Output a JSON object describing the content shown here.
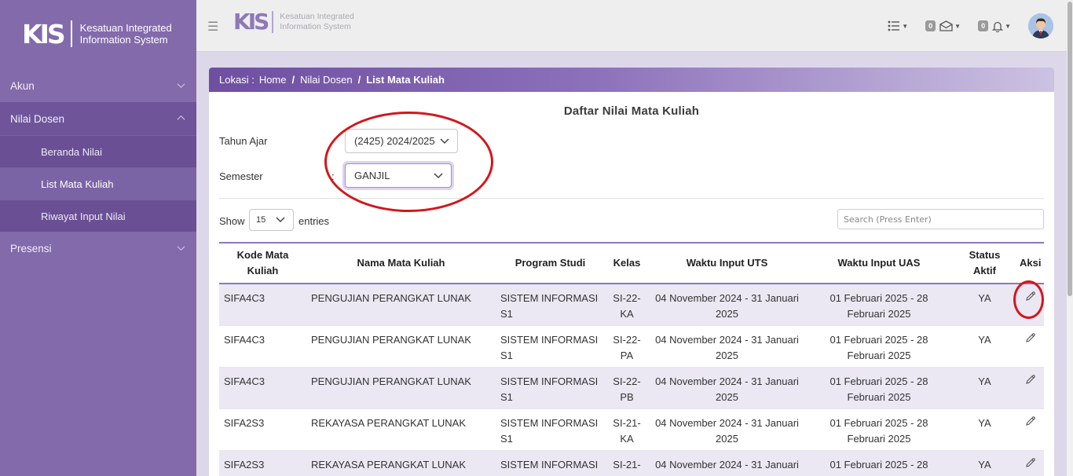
{
  "app": {
    "logo_text": "KIS",
    "name_line1": "Kesatuan Integrated",
    "name_line2": "Information System"
  },
  "sidebar": {
    "items": [
      {
        "label": "Akun",
        "icon": "chevron-down-icon"
      },
      {
        "label": "Nilai Dosen",
        "icon": "chevron-up-icon",
        "children": [
          {
            "label": "Beranda Nilai"
          },
          {
            "label": "List Mata Kuliah",
            "active": true
          },
          {
            "label": "Riwayat Input Nilai"
          }
        ]
      },
      {
        "label": "Presensi",
        "icon": "chevron-down-icon"
      }
    ]
  },
  "topbar": {
    "menu_icon": "hamburger-icon",
    "list_icon": "list-icon",
    "mail_count": "0",
    "mail_icon": "envelope-icon",
    "notif_count": "0",
    "notif_icon": "bell-icon",
    "avatar_icon": "user-avatar"
  },
  "breadcrumb": {
    "prefix": "Lokasi :",
    "items": [
      "Home",
      "Nilai Dosen",
      "List Mata Kuliah"
    ],
    "separator": "/"
  },
  "page_title": "Daftar Nilai Mata Kuliah",
  "filters": {
    "tahun_ajar_label": "Tahun Ajar",
    "tahun_ajar_value": "(2425) 2024/2025",
    "semester_label": "Semester",
    "semester_value": "GANJIL",
    "colon": ":"
  },
  "table_controls": {
    "show_label": "Show",
    "entries_value": "15",
    "entries_label": "entries",
    "search_placeholder": "Search (Press Enter)"
  },
  "table": {
    "headers": [
      "Kode Mata Kuliah",
      "Nama Mata Kuliah",
      "Program Studi",
      "Kelas",
      "Waktu Input UTS",
      "Waktu Input UAS",
      "Status Aktif",
      "Aksi"
    ],
    "rows": [
      {
        "kode": "SIFA4C3",
        "nama": "PENGUJIAN PERANGKAT LUNAK",
        "prodi": "SISTEM INFORMASI S1",
        "kelas": "SI-22-KA",
        "uts": "04 November 2024 - 31 Januari 2025",
        "uas": "01 Februari 2025 - 28 Februari 2025",
        "status": "YA"
      },
      {
        "kode": "SIFA4C3",
        "nama": "PENGUJIAN PERANGKAT LUNAK",
        "prodi": "SISTEM INFORMASI S1",
        "kelas": "SI-22-PA",
        "uts": "04 November 2024 - 31 Januari 2025",
        "uas": "01 Februari 2025 - 28 Februari 2025",
        "status": "YA"
      },
      {
        "kode": "SIFA4C3",
        "nama": "PENGUJIAN PERANGKAT LUNAK",
        "prodi": "SISTEM INFORMASI S1",
        "kelas": "SI-22-PB",
        "uts": "04 November 2024 - 31 Januari 2025",
        "uas": "01 Februari 2025 - 28 Februari 2025",
        "status": "YA"
      },
      {
        "kode": "SIFA2S3",
        "nama": "REKAYASA PERANGKAT LUNAK",
        "prodi": "SISTEM INFORMASI S1",
        "kelas": "SI-21-KA",
        "uts": "04 November 2024 - 31 Januari 2025",
        "uas": "01 Februari 2025 - 28 Februari 2025",
        "status": "YA"
      },
      {
        "kode": "SIFA2S3",
        "nama": "REKAYASA PERANGKAT LUNAK",
        "prodi": "SISTEM INFORMASI",
        "kelas": "SI-21-",
        "uts": "04 November 2024 - 31 Januari",
        "uas": "01 Februari 2025 - 28 Februari",
        "status": "YA"
      }
    ],
    "action_icon": "pencil-icon"
  },
  "colors": {
    "sidebar_bg": "#836aab",
    "accent": "#8f76b9",
    "annotation": "#d4161b"
  }
}
